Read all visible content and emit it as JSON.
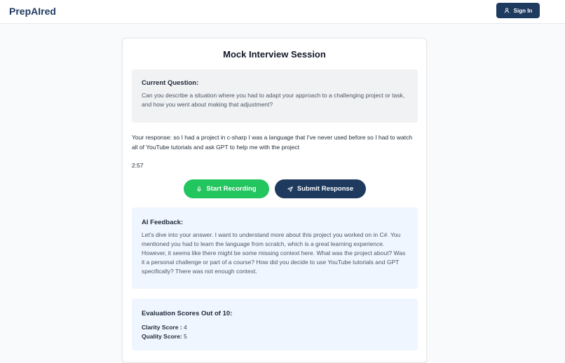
{
  "header": {
    "brand": "PrepAIred",
    "sign_in_label": "Sign In"
  },
  "session": {
    "title": "Mock Interview Session",
    "question_heading": "Current Question:",
    "question_text": "Can you describe a situation where you had to adapt your approach to a challenging project or task, and how you went about making that adjustment?",
    "response_text": "Your response: so I had a project in c-sharp I was a language that I've never used before so I had to watch all of YouTube tutorials and ask GPT to help me with the project",
    "timer": "2:57",
    "start_recording_label": "Start Recording",
    "submit_response_label": "Submit Response"
  },
  "feedback": {
    "heading": "AI Feedback:",
    "text": "Let's dive into your answer. I want to understand more about this project you worked on in C#. You mentioned you had to learn the language from scratch, which is a great learning experience. However, it seems like there might be some missing context here. What was the project about? Was it a personal challenge or part of a course? How did you decide to use YouTube tutorials and GPT specifically? There was not enough context."
  },
  "scores": {
    "heading": "Evaluation Scores Out of 10:",
    "clarity_label": "Clarity Score :",
    "clarity_value": "4",
    "quality_label": "Quality Score:",
    "quality_value": "5"
  },
  "icons": {
    "sign_in": "user-icon",
    "record": "microphone-icon",
    "submit": "send-icon"
  },
  "colors": {
    "brand": "#1e3a5f",
    "record_button": "#22c55e",
    "submit_button": "#1e3a5f",
    "feedback_bg": "#eff6ff",
    "question_bg": "#f1f2f4"
  }
}
